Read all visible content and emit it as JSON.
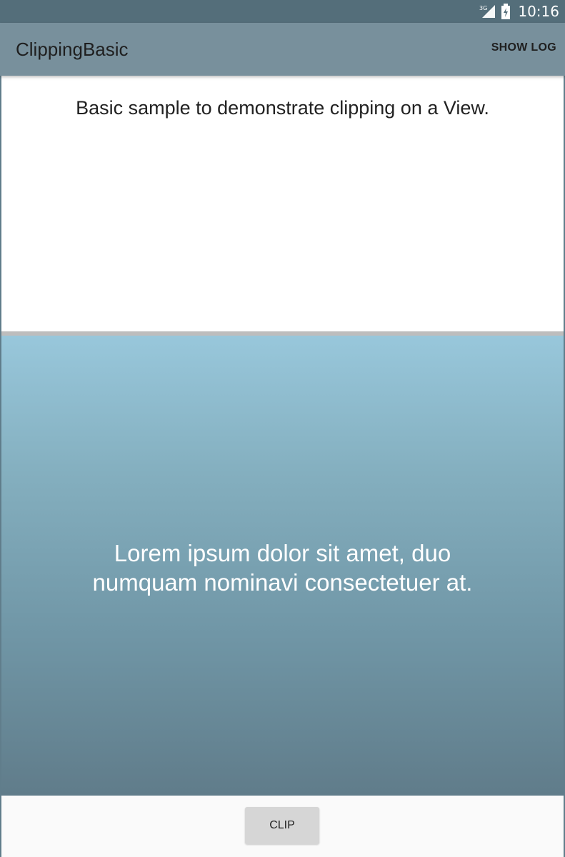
{
  "status_bar": {
    "network_label": "3G",
    "time": "10:16",
    "icons": [
      "signal-icon",
      "battery-icon"
    ]
  },
  "app_bar": {
    "title": "ClippingBasic",
    "show_log_label": "SHOW LOG"
  },
  "intro": {
    "text": "Basic sample to demonstrate clipping on a View."
  },
  "clip_view": {
    "text": "Lorem ipsum dolor sit amet, duo numquam nominavi consectetuer at.",
    "line1": "Lorem ipsum dolor sit amet, duo",
    "line2": "numquam nominavi consectetuer at."
  },
  "bottom_bar": {
    "clip_button_label": "CLIP"
  },
  "colors": {
    "status_bar": "#546e7a",
    "app_bar": "#78909c",
    "gradient_top": "#98c7db",
    "gradient_bottom": "#607c8a"
  }
}
